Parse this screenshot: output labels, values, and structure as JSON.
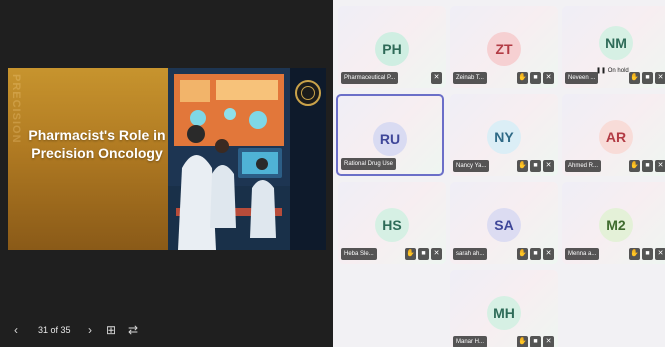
{
  "slide": {
    "title": "Pharmacist's Role in Precision Oncology",
    "ghost_text": "PRECISION"
  },
  "toolbar": {
    "prev_icon": "‹",
    "page_indicator": "31 of 35",
    "next_icon": "›",
    "grid_icon": "⊞",
    "swap_icon": "⇄"
  },
  "colors": {
    "active_border": "#6b6fc8",
    "toolbar_bg": "#1f1f1f"
  },
  "participants": [
    {
      "initials": "PH",
      "name": "Pharmaceutical P...",
      "avatar_bg": "#cfeee2",
      "avatar_fg": "#2e6b58",
      "icons": [
        "mic-off-icon"
      ]
    },
    {
      "initials": "ZT",
      "name": "Zeinab T...",
      "avatar_bg": "#f6d0d2",
      "avatar_fg": "#b23b44",
      "icons": [
        "hand-icon",
        "camera-off-icon",
        "mic-off-icon"
      ]
    },
    {
      "initials": "NM",
      "name": "Neveen ...",
      "avatar_bg": "#d6f0e4",
      "avatar_fg": "#2e6b58",
      "icons": [
        "hand-icon",
        "camera-off-icon",
        "mic-off-icon"
      ],
      "status": "On hold"
    },
    {
      "initials": "RU",
      "name": "Rational Drug Use",
      "avatar_bg": "#d9dbf2",
      "avatar_fg": "#3f4799",
      "icons": [],
      "active": true
    },
    {
      "initials": "NY",
      "name": "Nancy Ya...",
      "avatar_bg": "#dbeef6",
      "avatar_fg": "#2f6a86",
      "icons": [
        "hand-icon",
        "camera-off-icon",
        "mic-off-icon"
      ]
    },
    {
      "initials": "AR",
      "name": "Ahmed R...",
      "avatar_bg": "#f8dcd8",
      "avatar_fg": "#b23b44",
      "icons": [
        "hand-icon",
        "camera-off-icon",
        "mic-off-icon"
      ]
    },
    {
      "initials": "HS",
      "name": "Heba Sle...",
      "avatar_bg": "#d6f0e4",
      "avatar_fg": "#2e6b58",
      "icons": [
        "hand-icon",
        "camera-off-icon",
        "mic-off-icon"
      ]
    },
    {
      "initials": "SA",
      "name": "sarah ah...",
      "avatar_bg": "#dcdcf2",
      "avatar_fg": "#3f4799",
      "icons": [
        "hand-icon",
        "camera-off-icon",
        "mic-off-icon"
      ]
    },
    {
      "initials": "M2",
      "name": "Menna a...",
      "avatar_bg": "#e4f1d8",
      "avatar_fg": "#3f6b2e",
      "icons": [
        "hand-icon",
        "camera-off-icon",
        "mic-off-icon"
      ]
    },
    {
      "initials": "MH",
      "name": "Manar H...",
      "avatar_bg": "#d6f0e4",
      "avatar_fg": "#2e6b58",
      "icons": [
        "hand-icon",
        "camera-off-icon",
        "mic-off-icon"
      ]
    }
  ]
}
